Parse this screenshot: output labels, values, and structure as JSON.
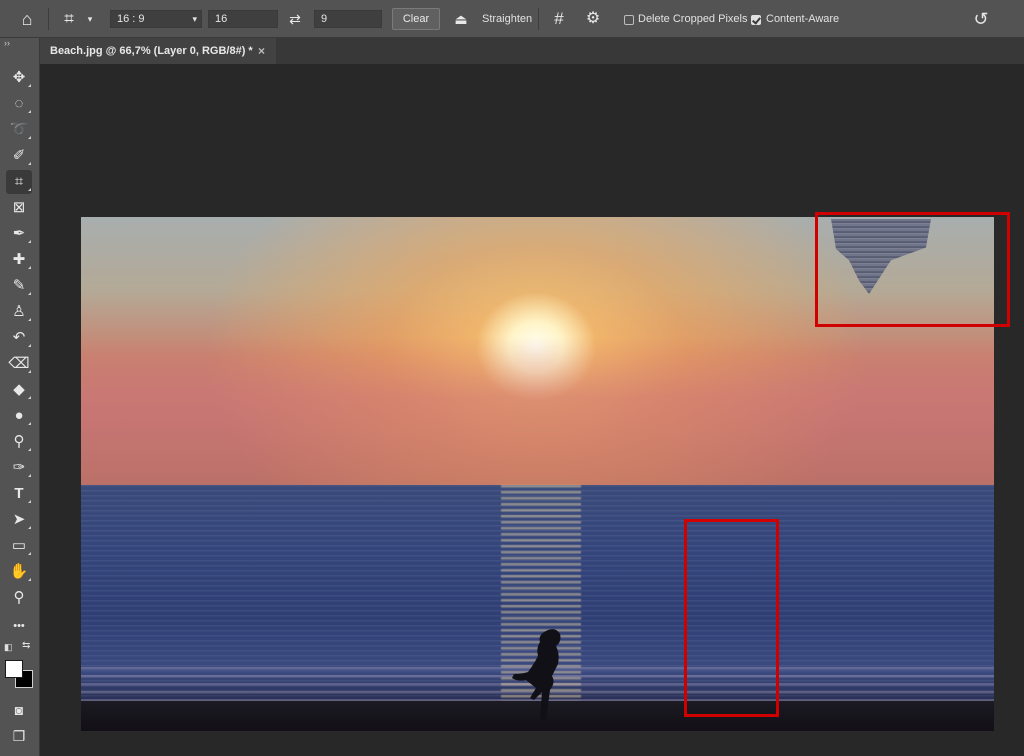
{
  "options_bar": {
    "home_icon": "home-icon",
    "crop_tool_icon": "crop-icon",
    "ratio_select": "16 : 9",
    "width_value": "16",
    "swap_icon": "swap-arrows-icon",
    "height_value": "9",
    "clear_label": "Clear",
    "straighten_icon": "level-icon",
    "straighten_label": "Straighten",
    "overlay_icon": "grid-icon",
    "settings_icon": "gear-icon",
    "delete_cropped_label": "Delete Cropped Pixels",
    "delete_cropped_checked": false,
    "content_aware_label": "Content-Aware",
    "content_aware_checked": true,
    "reset_icon": "undo-icon"
  },
  "document_tab": {
    "title": "Beach.jpg @ 66,7% (Layer 0, RGB/8#) *",
    "close": "×"
  },
  "toolbar": {
    "collapse": "››",
    "tools": [
      {
        "name": "move-tool",
        "icon": "✥",
        "active": false
      },
      {
        "name": "marquee-tool",
        "icon": "◌",
        "active": false
      },
      {
        "name": "lasso-tool",
        "icon": "➰",
        "active": false
      },
      {
        "name": "quick-selection-tool",
        "icon": "✐",
        "active": false
      },
      {
        "name": "crop-tool",
        "icon": "⌗",
        "active": true
      },
      {
        "name": "frame-tool",
        "icon": "⊠",
        "active": false
      },
      {
        "name": "eyedropper-tool",
        "icon": "✒",
        "active": false
      },
      {
        "name": "healing-brush-tool",
        "icon": "✚",
        "active": false
      },
      {
        "name": "brush-tool",
        "icon": "✎",
        "active": false
      },
      {
        "name": "clone-stamp-tool",
        "icon": "♙",
        "active": false
      },
      {
        "name": "history-brush-tool",
        "icon": "↶",
        "active": false
      },
      {
        "name": "eraser-tool",
        "icon": "⌫",
        "active": false
      },
      {
        "name": "paint-bucket-tool",
        "icon": "◆",
        "active": false
      },
      {
        "name": "blur-tool",
        "icon": "●",
        "active": false
      },
      {
        "name": "dodge-tool",
        "icon": "⚲",
        "active": false
      },
      {
        "name": "pen-tool",
        "icon": "✑",
        "active": false
      },
      {
        "name": "type-tool",
        "icon": "T",
        "active": false
      },
      {
        "name": "path-selection-tool",
        "icon": "➤",
        "active": false
      },
      {
        "name": "rectangle-tool",
        "icon": "▭",
        "active": false
      },
      {
        "name": "hand-tool",
        "icon": "✋",
        "active": false
      },
      {
        "name": "zoom-tool",
        "icon": "⚲",
        "active": false
      },
      {
        "name": "more-tools",
        "icon": "•••",
        "active": false
      }
    ],
    "foreground_color": "#ffffff",
    "background_color": "#000000",
    "quick-mask-icon": "quick-mask-icon",
    "screen-mode-icon": "screen-mode-icon"
  },
  "colors": {
    "highlight": "#d00000",
    "panel": "#535353",
    "workspace": "#282828"
  }
}
